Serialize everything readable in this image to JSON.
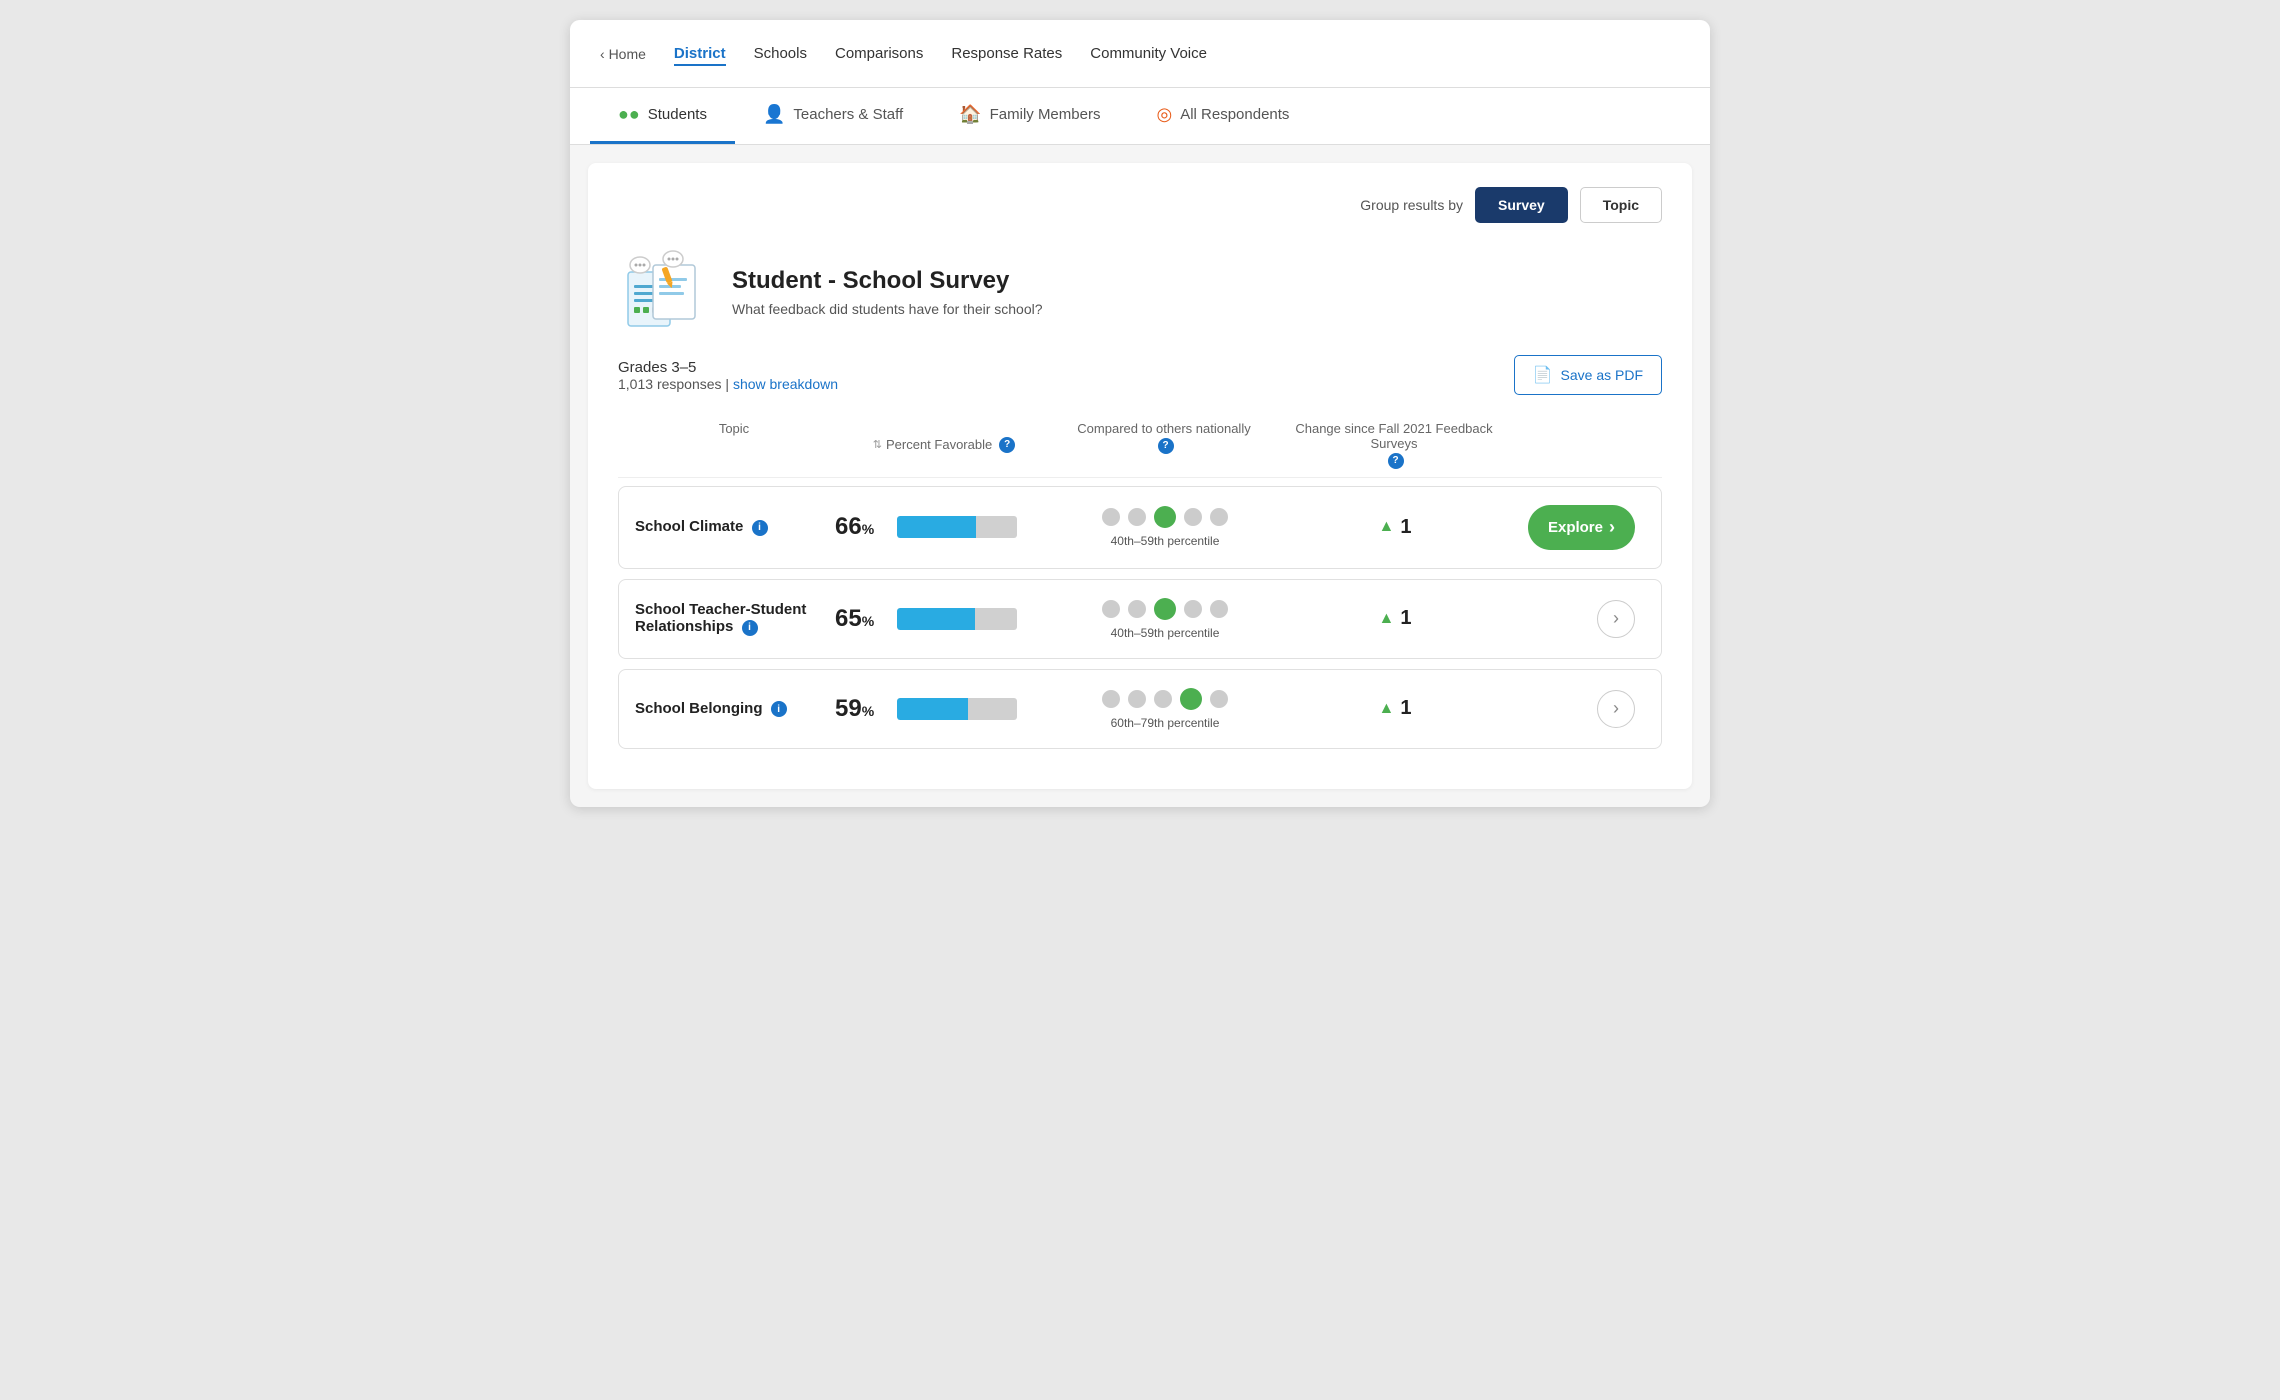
{
  "nav": {
    "home_label": "Home",
    "items": [
      {
        "id": "district",
        "label": "District",
        "active": true
      },
      {
        "id": "schools",
        "label": "Schools",
        "active": false
      },
      {
        "id": "comparisons",
        "label": "Comparisons",
        "active": false
      },
      {
        "id": "response-rates",
        "label": "Response Rates",
        "active": false
      },
      {
        "id": "community-voice",
        "label": "Community Voice",
        "active": false
      }
    ]
  },
  "respondent_tabs": [
    {
      "id": "students",
      "label": "Students",
      "icon": "●●",
      "active": true
    },
    {
      "id": "teachers",
      "label": "Teachers & Staff",
      "icon": "👤",
      "active": false
    },
    {
      "id": "family",
      "label": "Family Members",
      "icon": "🏠",
      "active": false
    },
    {
      "id": "all",
      "label": "All Respondents",
      "icon": "◎",
      "active": false
    }
  ],
  "group_results": {
    "label": "Group results by",
    "buttons": [
      {
        "id": "survey",
        "label": "Survey",
        "active": true
      },
      {
        "id": "topic",
        "label": "Topic",
        "active": false
      }
    ]
  },
  "survey": {
    "title": "Student - School Survey",
    "subtitle": "What feedback did students have for their school?",
    "grades": "Grades 3–5",
    "responses_count": "1,013",
    "responses_label": "responses",
    "show_breakdown": "show breakdown",
    "save_pdf_label": "Save as PDF"
  },
  "table_headers": {
    "topic": "Topic",
    "percent_favorable": "Percent Favorable",
    "compared_nationally": "Compared to others nationally",
    "change_since": "Change since Fall 2021 Feedback Surveys"
  },
  "topics": [
    {
      "name": "School Climate",
      "percent": 66,
      "bar_percent": 66,
      "percentile_label": "40th–59th percentile",
      "active_dot": 2,
      "change": 1,
      "has_explore": true,
      "has_info": true
    },
    {
      "name": "School Teacher-Student Relationships",
      "percent": 65,
      "bar_percent": 65,
      "percentile_label": "40th–59th percentile",
      "active_dot": 2,
      "change": 1,
      "has_explore": false,
      "has_info": true
    },
    {
      "name": "School Belonging",
      "percent": 59,
      "bar_percent": 59,
      "percentile_label": "60th–79th percentile",
      "active_dot": 3,
      "change": 1,
      "has_explore": false,
      "has_info": true
    }
  ]
}
